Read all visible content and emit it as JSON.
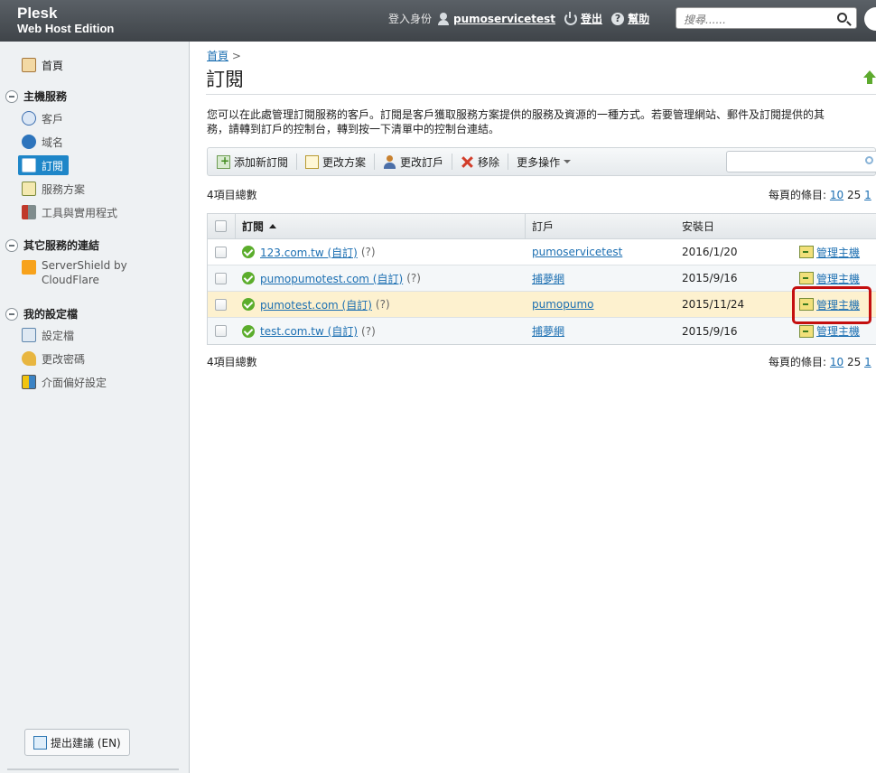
{
  "brand": {
    "line1": "Plesk",
    "line2": "Web Host Edition"
  },
  "topbar": {
    "logged_in_as": "登入身份",
    "username": "pumoservicetest",
    "logout": "登出",
    "help": "幫助",
    "search_placeholder": "搜尋......",
    "help_icon_glyph": "?"
  },
  "sidebar": {
    "home": "首頁",
    "groups": [
      {
        "label": "主機服務",
        "items": [
          "客戶",
          "域名",
          "訂閱",
          "服務方案",
          "工具與實用程式"
        ]
      },
      {
        "label": "其它服務的連結",
        "items": [
          "ServerShield by",
          "CloudFlare"
        ]
      },
      {
        "label": "我的設定檔",
        "items": [
          "設定檔",
          "更改密碼",
          "介面偏好設定"
        ]
      }
    ],
    "feedback": "提出建議 (EN)"
  },
  "main": {
    "breadcrumb": "首頁",
    "breadcrumb_sep": ">",
    "title": "訂閱",
    "description_line1": "您可以在此處管理訂閱服務的客戶。訂閱是客戶獲取服務方案提供的服務及資源的一種方式。若要管理網站、郵件及訂閱提供的其",
    "description_line2": "務，請轉到訂戶的控制台，轉到按一下清單中的控制台連結。",
    "toolbar": {
      "add": "添加新訂閱",
      "change_plan": "更改方案",
      "change_subscriber": "更改訂戶",
      "remove": "移除",
      "more": "更多操作"
    },
    "total": "4項目總數",
    "per_page_label": "每頁的條目:",
    "per_page_options": [
      "10",
      "25",
      "1"
    ],
    "columns": {
      "subscription": "訂閱",
      "subscriber": "訂戶",
      "setup_date": "安裝日"
    },
    "rows": [
      {
        "domain": "123.com.tw (自訂)",
        "q": "(?)",
        "subscriber": "pumoservicetest",
        "date": "2016/1/20",
        "action": "管理主機"
      },
      {
        "domain": "pumopumotest.com (自訂)",
        "q": "(?)",
        "subscriber": "捕夢網",
        "date": "2015/9/16",
        "action": "管理主機"
      },
      {
        "domain": "pumotest.com (自訂)",
        "q": "(?)",
        "subscriber": "pumopumo",
        "date": "2015/11/24",
        "action": "管理主機"
      },
      {
        "domain": "test.com.tw (自訂)",
        "q": "(?)",
        "subscriber": "捕夢網",
        "date": "2015/9/16",
        "action": "管理主機"
      }
    ]
  }
}
